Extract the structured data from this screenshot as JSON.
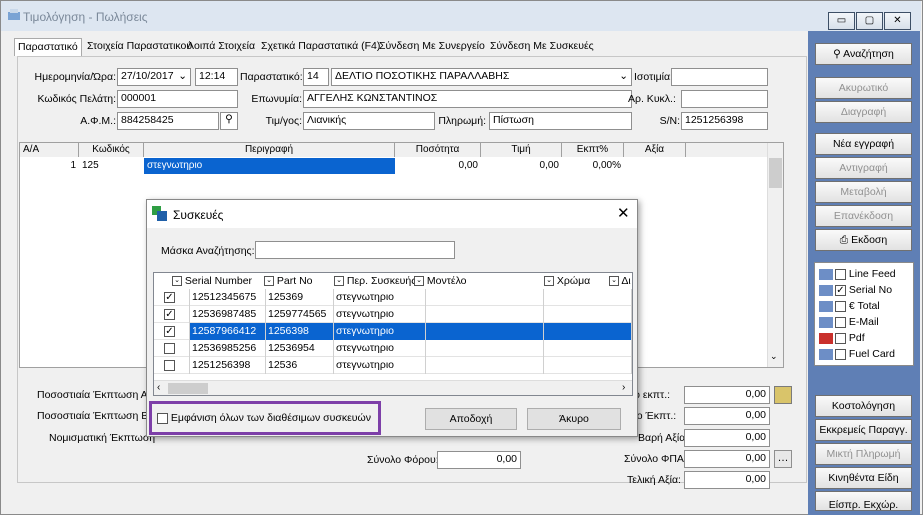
{
  "window": {
    "title": "Τιμολόγηση - Πωλήσεις"
  },
  "tabs": [
    "Παραστατικό",
    "Στοιχεία Παραστατικού",
    "Λοιπά Στοιχεία",
    "Σχετικά Παραστατικά (F4)",
    "Σύνδεση Με Συνεργείο",
    "Σύνδεση Με Συσκευές"
  ],
  "header": {
    "date_label": "Ημερομηνία/Ώρα:",
    "date": "27/10/2017",
    "time": "12:14",
    "doc_label": "Παραστατικό:",
    "doc_code": "14",
    "doc_name": "ΔΕΛΤΙΟ ΠΟΣΟΤΙΚΗΣ ΠΑΡΑΛΛΑΒΗΣ",
    "isotimia_label": "Ισοτιμία:",
    "isotimia": "",
    "customer_label": "Κωδικός Πελάτη:",
    "customer": "000001",
    "name_label": "Επωνυμία:",
    "name": "ΑΓΓΕΛΗΣ ΚΩΝΣΤΑΝΤΙΝΟΣ",
    "arkykl_label": "Αρ. Κυκλ.:",
    "arkykl": "",
    "afm_label": "Α.Φ.Μ.:",
    "afm": "884258425",
    "pricelist_label": "Τιμ/γος:",
    "pricelist": "Λιανικής",
    "payment_label": "Πληρωμή:",
    "payment": "Πίστωση",
    "sn_label": "S/N:",
    "sn": "1251256398"
  },
  "grid": {
    "columns": [
      "Α/Α",
      "Κωδικός",
      "Περιγραφή",
      "Ποσότητα",
      "Τιμή",
      "Εκπτ%",
      "Αξία"
    ],
    "rows": [
      {
        "aa": "1",
        "code": "125",
        "desc": "στεγνωτηριο",
        "qty": "0,00",
        "price": "0,00",
        "disc": "0,00%",
        "value": ""
      }
    ]
  },
  "sidebar": {
    "search": "Αναζήτηση",
    "cancel": "Ακυρωτικό",
    "delete": "Διαγραφή",
    "new": "Νέα εγγραφή",
    "copy": "Αντιγραφή",
    "transfer": "Μεταβολή",
    "reissue": "Επανέκδοση",
    "print": "Εκδοση",
    "options": [
      {
        "label": "Line Feed",
        "checked": false
      },
      {
        "label": "Serial No",
        "checked": true
      },
      {
        "label": "€ Total",
        "checked": false
      },
      {
        "label": "E-Mail",
        "checked": false
      },
      {
        "label": "Pdf",
        "checked": false
      },
      {
        "label": "Fuel Card",
        "checked": false
      }
    ],
    "costing": "Κοστολόγηση",
    "pending": "Εκκρεμείς Παραγγ.",
    "mixed": "Μικτή Πληρωμή",
    "moving": "Κινηθέντα Είδη",
    "last": "Είσπρ. Εκχώρ."
  },
  "footer": {
    "pct1": "Ποσοστιαία Έκπτωση Α",
    "pct2": "Ποσοστιαία Έκπτωση Β",
    "money": "Νομισματική Έκπτωση",
    "tax_label": "Σύνολο Φόρου:",
    "tax": "0,00",
    "r1_label": "τρο εκπτ.:",
    "r1": "0,00",
    "r2_label": "ολο Έκπτ.:",
    "r2": "0,00",
    "r3_label": "Βαρή Αξία:",
    "r3": "0,00",
    "vat_label": "Σύνολο ΦΠΑ:",
    "vat": "0,00",
    "total_label": "Τελική Αξία:",
    "total": "0,00"
  },
  "dialog": {
    "title": "Συσκευές",
    "mask_label": "Μάσκα Αναζήτησης:",
    "mask": "",
    "columns": [
      "Serial Number",
      "Part No",
      "Περ. Συσκευής",
      "Μοντέλο",
      "Χρώμα",
      "Δι"
    ],
    "rows": [
      {
        "checked": true,
        "serial": "12512345675",
        "part": "125369",
        "desc": "στεγνωτηριο",
        "selected": false
      },
      {
        "checked": true,
        "serial": "12536987485",
        "part": "1259774565",
        "desc": "στεγνωτηριο",
        "selected": false
      },
      {
        "checked": true,
        "serial": "12587966412",
        "part": "1256398",
        "desc": "στεγνωτηριο",
        "selected": true
      },
      {
        "checked": false,
        "serial": "12536985256",
        "part": "12536954",
        "desc": "στεγνωτηριο",
        "selected": false
      },
      {
        "checked": false,
        "serial": "1251256398",
        "part": "12536",
        "desc": "στεγνωτηριο",
        "selected": false
      }
    ],
    "show_all": "Εμφάνιση όλων των διαθέσιμων συσκευών",
    "accept": "Αποδοχή",
    "cancel": "Άκυρο"
  }
}
